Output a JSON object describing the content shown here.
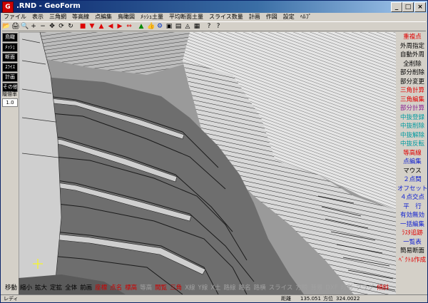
{
  "window": {
    "title": ".RND - GeoForm",
    "minimize": "_",
    "maximize": "□",
    "close": "×",
    "app_icon": "G"
  },
  "menubar": [
    "ファイル",
    "表示",
    "三角網",
    "等高線",
    "点編集",
    "鳥瞰図",
    "ﾒｯｼｭ土量",
    "平均断面土量",
    "スライス数量",
    "計画",
    "作図",
    "設定",
    "ﾍﾙﾌﾟ"
  ],
  "toolbar": {
    "icons": [
      "open-icon",
      "print-icon",
      "zoom-icon",
      "plus-icon",
      "minus-icon",
      "move-icon",
      "rotate-icon",
      "refresh-icon",
      "red-cube-icon",
      "arrow-down-icon",
      "arrow-up-icon",
      "arrow-left-icon",
      "arrow-right-icon",
      "arrow-double-icon",
      "terrain-icon",
      "thumb-icon",
      "settings-icon",
      "window-icon",
      "layers-icon",
      "contour-icon",
      "grid-icon",
      "help-icon",
      "context-help-icon"
    ],
    "glyphs": [
      "📂",
      "🖨",
      "🔍",
      "+",
      "−",
      "✥",
      "⟳",
      "↻",
      "■",
      "▼",
      "▲",
      "◀",
      "▶",
      "⇔",
      "▲",
      "👍",
      "⚙",
      "▣",
      "▤",
      "◬",
      "▦",
      "?",
      "?"
    ]
  },
  "left_panel": {
    "buttons": [
      "鳥瞰",
      "ﾒｯｼｭ",
      "断面",
      "ｽﾗｲｽ",
      "計画",
      "その他"
    ],
    "ratio_label": "縦倍率",
    "ratio_value": "1.0"
  },
  "right_panel": [
    {
      "label": "重複点",
      "color": "red"
    },
    {
      "label": "外周指定",
      "color": "black"
    },
    {
      "label": "自動外周",
      "color": "black"
    },
    {
      "label": "全削除",
      "color": "black"
    },
    {
      "label": "部分削除",
      "color": "black"
    },
    {
      "label": "部分変更",
      "color": "black"
    },
    {
      "label": "三角計算",
      "color": "red"
    },
    {
      "label": "三角編集",
      "color": "red"
    },
    {
      "label": "部分計算",
      "color": "purple"
    },
    {
      "label": "中抜登録",
      "color": "teal"
    },
    {
      "label": "中抜削除",
      "color": "teal"
    },
    {
      "label": "中抜解除",
      "color": "teal"
    },
    {
      "label": "中抜反転",
      "color": "teal"
    },
    {
      "label": "等高線",
      "color": "red"
    },
    {
      "label": "点編集",
      "color": "blue"
    },
    {
      "label": "マウス",
      "color": "black"
    },
    {
      "label": "２点間",
      "color": "blue"
    },
    {
      "label": "オフセット",
      "color": "blue"
    },
    {
      "label": "４点交点",
      "color": "blue"
    },
    {
      "label": "平　行",
      "color": "blue"
    },
    {
      "label": "有効無効",
      "color": "blue"
    },
    {
      "label": "一括編集",
      "color": "blue"
    },
    {
      "label": "ﾗｽﾀ追跡",
      "color": "red"
    },
    {
      "label": "一覧表",
      "color": "blue"
    },
    {
      "label": "簡易断面",
      "color": "black"
    },
    {
      "label": "ﾍﾞｸﾄﾙ作成",
      "color": "red"
    }
  ],
  "bottom_bar": [
    {
      "label": "移動",
      "style": "normal"
    },
    {
      "label": "縮小",
      "style": "normal"
    },
    {
      "label": "拡大",
      "style": "normal"
    },
    {
      "label": "定拡",
      "style": "normal"
    },
    {
      "label": "全体",
      "style": "normal"
    },
    {
      "label": "前画",
      "style": "normal"
    },
    {
      "label": "座標",
      "style": "red"
    },
    {
      "label": "点名",
      "style": "red"
    },
    {
      "label": "標高",
      "style": "red"
    },
    {
      "label": "等高",
      "style": "gray"
    },
    {
      "label": "閲覧",
      "style": "red"
    },
    {
      "label": "三角",
      "style": "red"
    },
    {
      "label": "X線",
      "style": "gray"
    },
    {
      "label": "Y線",
      "style": "gray"
    },
    {
      "label": "X土",
      "style": "gray"
    },
    {
      "label": "路線",
      "style": "gray"
    },
    {
      "label": "路名",
      "style": "gray"
    },
    {
      "label": "路横",
      "style": "gray"
    },
    {
      "label": "スライス",
      "style": "gray"
    },
    {
      "label": "方眼",
      "style": "gray"
    },
    {
      "label": "背景",
      "style": "gray"
    },
    {
      "label": "DXF",
      "style": "gray"
    },
    {
      "label": "段彩",
      "style": "gray"
    },
    {
      "label": "フラグ",
      "style": "gray"
    },
    {
      "label": "傾斜",
      "style": "red"
    }
  ],
  "statusbar": {
    "text": "レディ",
    "distance_label": "距離",
    "distance_value": "135.051",
    "direction_label": "方位",
    "direction_value": "324.0022"
  }
}
